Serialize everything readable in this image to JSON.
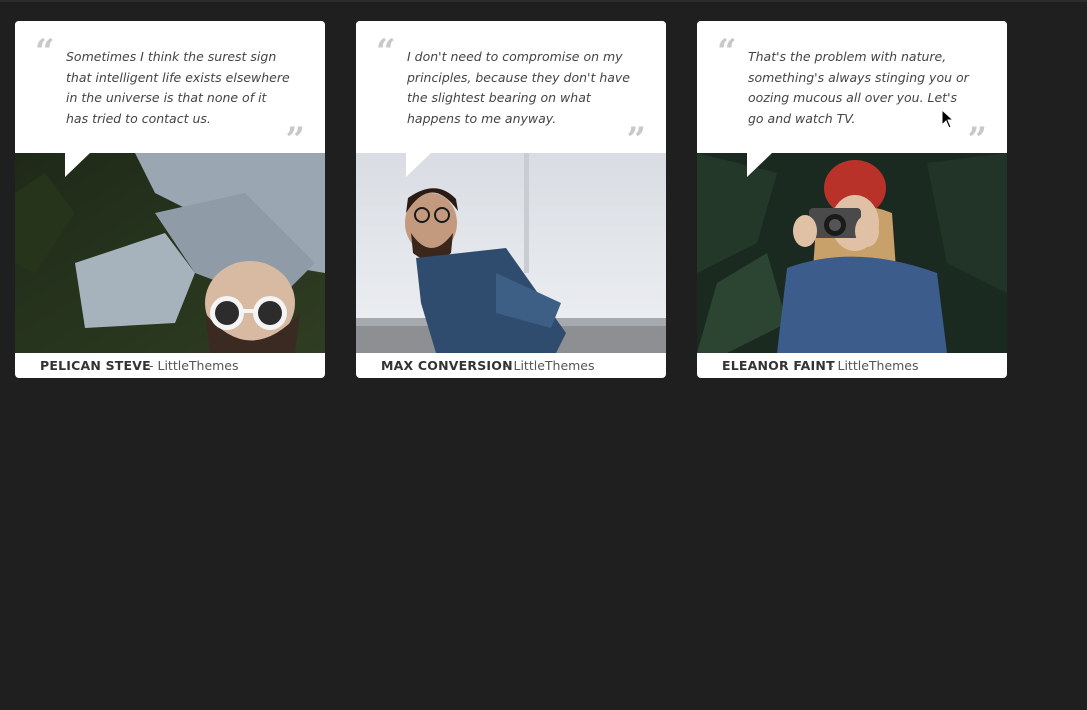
{
  "testimonials": [
    {
      "quote": "Sometimes I think the surest sign that intelligent life exists elsewhere in the universe is that none of it has tried to contact us.",
      "name": "PELICAN STEVE",
      "source": "- LittleThemes"
    },
    {
      "quote": "I don't need to compromise on my principles, because they don't have the slightest bearing on what happens to me anyway.",
      "name": "MAX CONVERSION",
      "source": "- LittleThemes"
    },
    {
      "quote": "That's the problem with nature, something's always stinging you or oozing mucous all over you. Let's go and watch TV.",
      "name": "ELEANOR FAINT",
      "source": "- LittleThemes"
    }
  ],
  "quote_marks": {
    "open": "“",
    "close": "”"
  },
  "colors": {
    "background": "#1f1f1f",
    "card": "#ffffff",
    "quote_mark": "#c8c8c8"
  }
}
